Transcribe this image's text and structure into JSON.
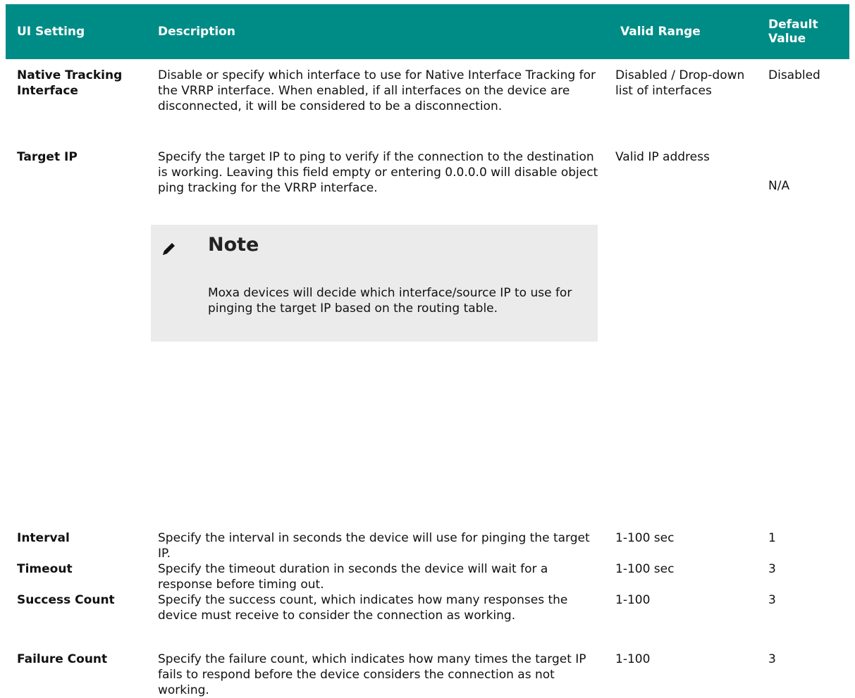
{
  "table": {
    "headers": {
      "ui_setting": "UI Setting",
      "description": "Description",
      "valid_range": "Valid Range",
      "default_value": "Default Value"
    },
    "header_color": "#008c86",
    "rows": [
      {
        "setting": "Native Tracking Interface",
        "description": "Disable or specify which interface to use for Native Interface Tracking for the VRRP interface. When enabled, if all interfaces on the device are disconnected, it will be considered to be a disconnection.",
        "valid_range": "Disabled / Drop-down list of interfaces",
        "default": "Disabled"
      },
      {
        "setting": "Target IP",
        "description": "Specify the target IP to ping to verify if the connection to the destination is working. Leaving this field empty or entering 0.0.0.0 will disable object ping tracking for the VRRP interface.",
        "valid_range": "Valid IP address",
        "default": "N/A",
        "note": {
          "icon": "pencil-icon",
          "title": "Note",
          "text": "Moxa devices will decide which interface/source IP to use for pinging the target IP based on the routing table."
        }
      },
      {
        "setting": "Interval",
        "description": "Specify the interval in seconds the device will use for pinging the target IP.",
        "valid_range": "1-100 sec",
        "default": "1"
      },
      {
        "setting": "Timeout",
        "description": "Specify the timeout duration in seconds the device will wait for a response before timing out.",
        "valid_range": "1-100 sec",
        "default": "3"
      },
      {
        "setting": "Success Count",
        "description": "Specify the success count, which indicates how many responses the device must receive to consider the connection as working.",
        "valid_range": "1-100",
        "default": "3"
      },
      {
        "setting": "Failure Count",
        "description": "Specify the failure count, which indicates how many times the target IP fails to respond before the device considers the connection as not working.",
        "valid_range": "1-100",
        "default": "3"
      }
    ]
  }
}
